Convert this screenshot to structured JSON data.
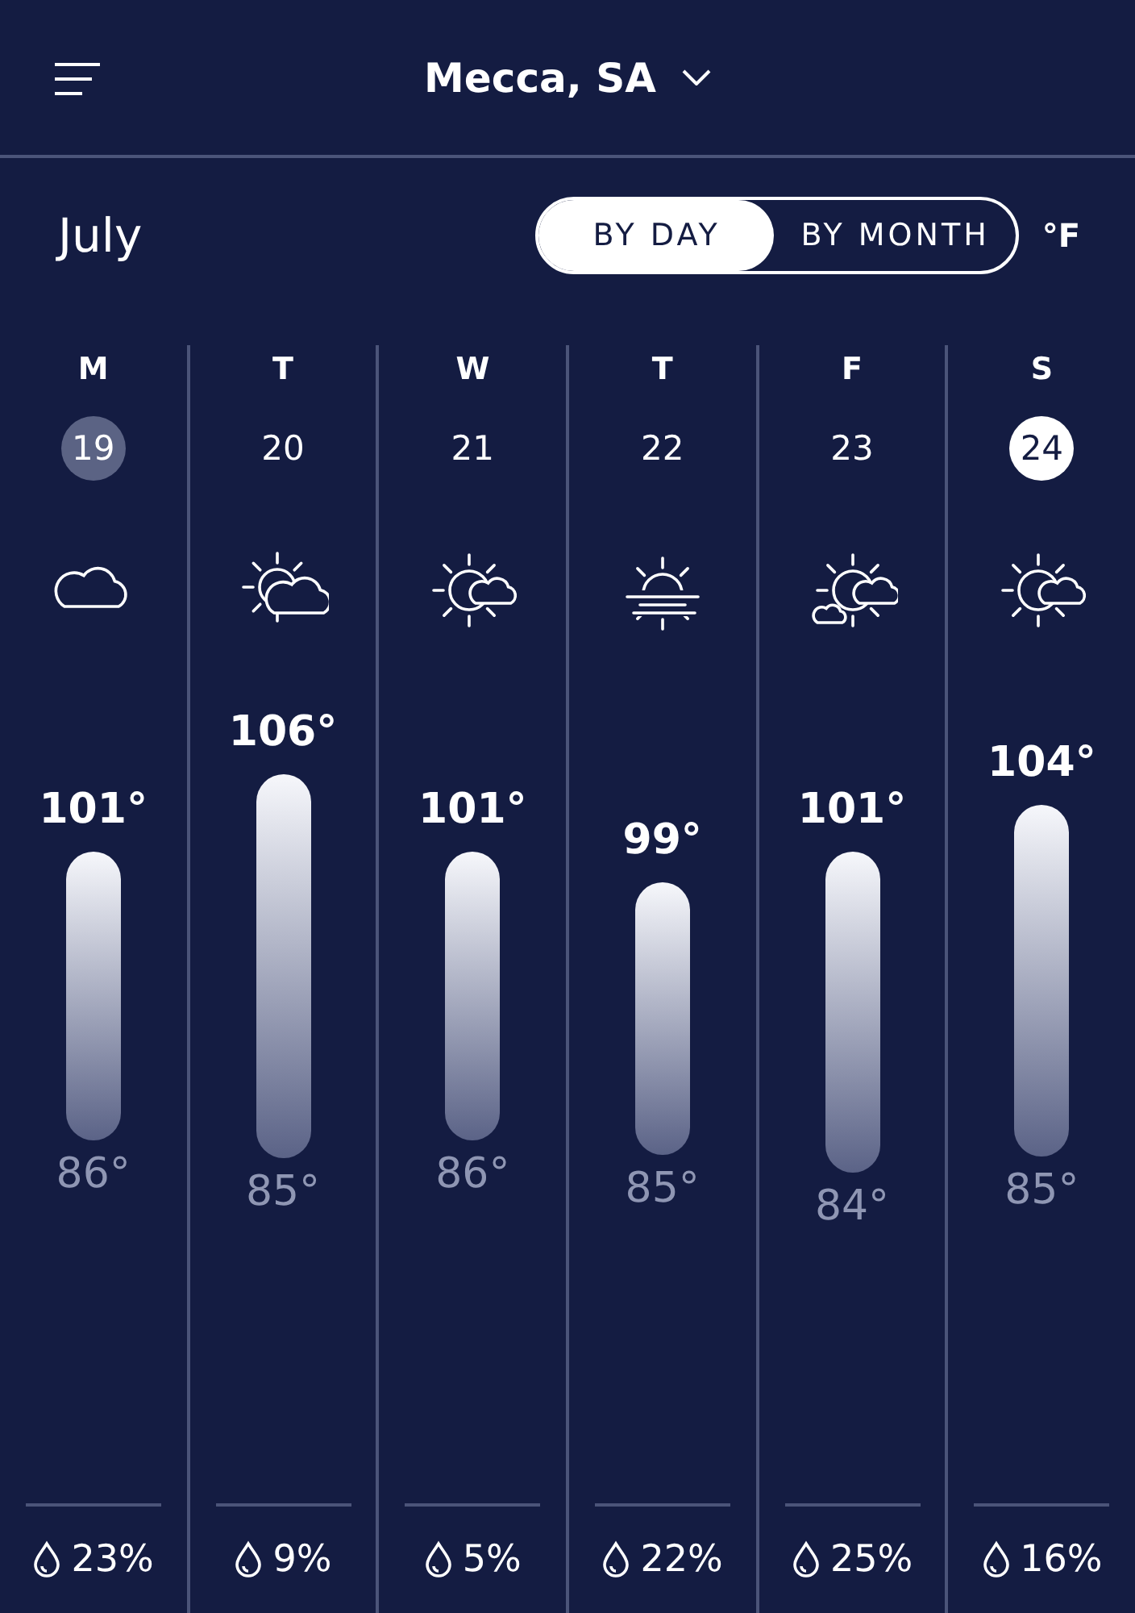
{
  "header": {
    "location": "Mecca, SA"
  },
  "month": "July",
  "view_toggle": [
    {
      "label": "BY DAY",
      "selected": true
    },
    {
      "label": "BY MONTH",
      "selected": false
    }
  ],
  "unit": "°F",
  "days": [
    {
      "weekday": "M",
      "date": "19",
      "today": true,
      "selected": false,
      "kind": "cloudy",
      "high": "101°",
      "low": "86°",
      "precip": "23%"
    },
    {
      "weekday": "T",
      "date": "20",
      "today": false,
      "selected": false,
      "kind": "partly",
      "high": "106°",
      "low": "85°",
      "precip": "9%"
    },
    {
      "weekday": "W",
      "date": "21",
      "today": false,
      "selected": false,
      "kind": "sunny",
      "high": "101°",
      "low": "86°",
      "precip": "5%"
    },
    {
      "weekday": "T",
      "date": "22",
      "today": false,
      "selected": false,
      "kind": "hazy",
      "high": "99°",
      "low": "85°",
      "precip": "22%"
    },
    {
      "weekday": "F",
      "date": "23",
      "today": false,
      "selected": false,
      "kind": "mixed",
      "high": "101°",
      "low": "84°",
      "precip": "25%"
    },
    {
      "weekday": "S",
      "date": "24",
      "today": false,
      "selected": true,
      "kind": "sunny",
      "high": "104°",
      "low": "85°",
      "precip": "16%"
    }
  ]
}
